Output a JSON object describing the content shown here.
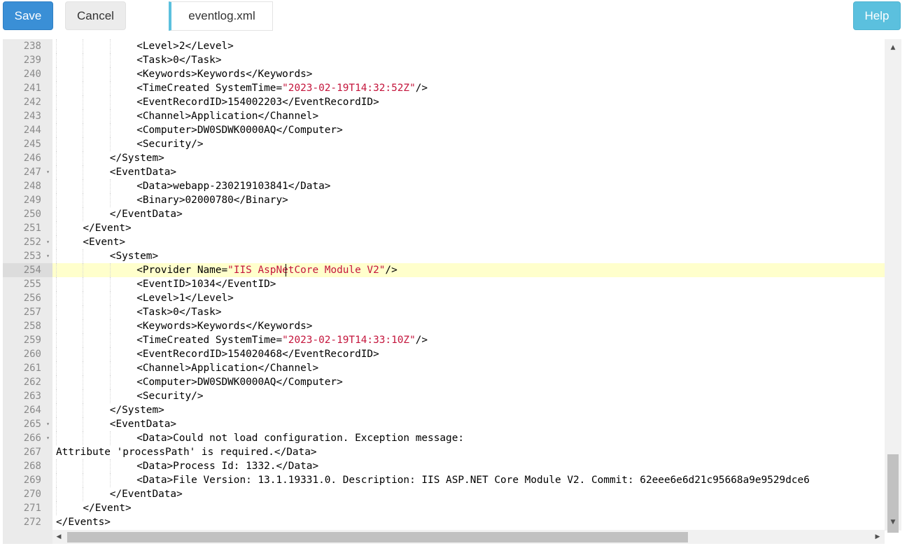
{
  "toolbar": {
    "save_label": "Save",
    "cancel_label": "Cancel",
    "help_label": "Help"
  },
  "tab": {
    "label": "eventlog.xml"
  },
  "editor": {
    "active_line": 254,
    "lines": [
      {
        "num": "238",
        "indent": 3,
        "fold": false,
        "parts": [
          {
            "t": "<Level>2</Level>"
          }
        ]
      },
      {
        "num": "239",
        "indent": 3,
        "fold": false,
        "parts": [
          {
            "t": "<Task>0</Task>"
          }
        ]
      },
      {
        "num": "240",
        "indent": 3,
        "fold": false,
        "parts": [
          {
            "t": "<Keywords>Keywords</Keywords>"
          }
        ]
      },
      {
        "num": "241",
        "indent": 3,
        "fold": false,
        "parts": [
          {
            "t": "<TimeCreated SystemTime="
          },
          {
            "t": "\"2023-02-19T14:32:52Z\"",
            "s": true
          },
          {
            "t": "/>"
          }
        ]
      },
      {
        "num": "242",
        "indent": 3,
        "fold": false,
        "parts": [
          {
            "t": "<EventRecordID>154002203</EventRecordID>"
          }
        ]
      },
      {
        "num": "243",
        "indent": 3,
        "fold": false,
        "parts": [
          {
            "t": "<Channel>Application</Channel>"
          }
        ]
      },
      {
        "num": "244",
        "indent": 3,
        "fold": false,
        "parts": [
          {
            "t": "<Computer>DW0SDWK0000AQ</Computer>"
          }
        ]
      },
      {
        "num": "245",
        "indent": 3,
        "fold": false,
        "parts": [
          {
            "t": "<Security/>"
          }
        ]
      },
      {
        "num": "246",
        "indent": 2,
        "fold": false,
        "parts": [
          {
            "t": "</System>"
          }
        ]
      },
      {
        "num": "247",
        "indent": 2,
        "fold": true,
        "parts": [
          {
            "t": "<EventData>"
          }
        ]
      },
      {
        "num": "248",
        "indent": 3,
        "fold": false,
        "parts": [
          {
            "t": "<Data>webapp-230219103841</Data>"
          }
        ]
      },
      {
        "num": "249",
        "indent": 3,
        "fold": false,
        "parts": [
          {
            "t": "<Binary>02000780</Binary>"
          }
        ]
      },
      {
        "num": "250",
        "indent": 2,
        "fold": false,
        "parts": [
          {
            "t": "</EventData>"
          }
        ]
      },
      {
        "num": "251",
        "indent": 1,
        "fold": false,
        "parts": [
          {
            "t": "</Event>"
          }
        ]
      },
      {
        "num": "252",
        "indent": 1,
        "fold": true,
        "parts": [
          {
            "t": "<Event>"
          }
        ]
      },
      {
        "num": "253",
        "indent": 2,
        "fold": true,
        "parts": [
          {
            "t": "<System>"
          }
        ]
      },
      {
        "num": "254",
        "indent": 3,
        "fold": false,
        "parts": [
          {
            "t": "<Provider Name="
          },
          {
            "t": "\"IIS AspNetCore Module V2\"",
            "s": true
          },
          {
            "t": "/>"
          }
        ]
      },
      {
        "num": "255",
        "indent": 3,
        "fold": false,
        "parts": [
          {
            "t": "<EventID>1034</EventID>"
          }
        ]
      },
      {
        "num": "256",
        "indent": 3,
        "fold": false,
        "parts": [
          {
            "t": "<Level>1</Level>"
          }
        ]
      },
      {
        "num": "257",
        "indent": 3,
        "fold": false,
        "parts": [
          {
            "t": "<Task>0</Task>"
          }
        ]
      },
      {
        "num": "258",
        "indent": 3,
        "fold": false,
        "parts": [
          {
            "t": "<Keywords>Keywords</Keywords>"
          }
        ]
      },
      {
        "num": "259",
        "indent": 3,
        "fold": false,
        "parts": [
          {
            "t": "<TimeCreated SystemTime="
          },
          {
            "t": "\"2023-02-19T14:33:10Z\"",
            "s": true
          },
          {
            "t": "/>"
          }
        ]
      },
      {
        "num": "260",
        "indent": 3,
        "fold": false,
        "parts": [
          {
            "t": "<EventRecordID>154020468</EventRecordID>"
          }
        ]
      },
      {
        "num": "261",
        "indent": 3,
        "fold": false,
        "parts": [
          {
            "t": "<Channel>Application</Channel>"
          }
        ]
      },
      {
        "num": "262",
        "indent": 3,
        "fold": false,
        "parts": [
          {
            "t": "<Computer>DW0SDWK0000AQ</Computer>"
          }
        ]
      },
      {
        "num": "263",
        "indent": 3,
        "fold": false,
        "parts": [
          {
            "t": "<Security/>"
          }
        ]
      },
      {
        "num": "264",
        "indent": 2,
        "fold": false,
        "parts": [
          {
            "t": "</System>"
          }
        ]
      },
      {
        "num": "265",
        "indent": 2,
        "fold": true,
        "parts": [
          {
            "t": "<EventData>"
          }
        ]
      },
      {
        "num": "266",
        "indent": 3,
        "fold": true,
        "parts": [
          {
            "t": "<Data>Could not load configuration. Exception message:"
          }
        ]
      },
      {
        "num": "267",
        "indent": 0,
        "fold": false,
        "parts": [
          {
            "t": "Attribute 'processPath' is required.</Data>"
          }
        ]
      },
      {
        "num": "268",
        "indent": 3,
        "fold": false,
        "parts": [
          {
            "t": "<Data>Process Id: 1332.</Data>"
          }
        ]
      },
      {
        "num": "269",
        "indent": 3,
        "fold": false,
        "parts": [
          {
            "t": "<Data>File Version: 13.1.19331.0. Description: IIS ASP.NET Core Module V2. Commit: 62eee6e6d21c95668a9e9529dce6"
          }
        ]
      },
      {
        "num": "270",
        "indent": 2,
        "fold": false,
        "parts": [
          {
            "t": "</EventData>"
          }
        ]
      },
      {
        "num": "271",
        "indent": 1,
        "fold": false,
        "parts": [
          {
            "t": "</Event>"
          }
        ]
      },
      {
        "num": "272",
        "indent": 0,
        "fold": false,
        "parts": [
          {
            "t": "</Events>"
          }
        ]
      }
    ]
  },
  "colors": {
    "save": "#3a8fd6",
    "help": "#5bc0de",
    "string": "#c4153c",
    "active_line": "#ffffcc"
  }
}
